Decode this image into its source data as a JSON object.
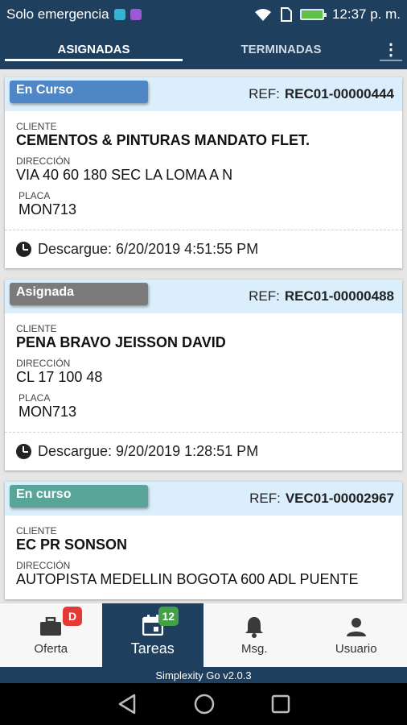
{
  "status_bar": {
    "carrier": "Solo emergencia",
    "time": "12:37 p. m."
  },
  "tabs": [
    {
      "label": "ASIGNADAS",
      "active": true
    },
    {
      "label": "TERMINADAS",
      "active": false
    }
  ],
  "overflow_icon": "⋮",
  "cards": [
    {
      "status": "En Curso",
      "status_color": "#4f86c6",
      "ref_label": "REF:",
      "ref": "REC01-00000444",
      "cliente_label": "CLIENTE",
      "cliente": "CEMENTOS & PINTURAS MANDATO FLET.",
      "direccion_label": "DIRECCIÓN",
      "direccion": "VIA 40 60 180 SEC LA LOMA A N",
      "placa_label": "PLACA",
      "placa": "MON713",
      "descargue": "Descargue: 6/20/2019 4:51:55 PM"
    },
    {
      "status": "Asignada",
      "status_color": "#7b7b7b",
      "ref_label": "REF:",
      "ref": "REC01-00000488",
      "cliente_label": "CLIENTE",
      "cliente": "PENA BRAVO JEISSON DAVID",
      "direccion_label": "DIRECCIÓN",
      "direccion": "CL 17 100 48",
      "placa_label": "PLACA",
      "placa": "MON713",
      "descargue": "Descargue: 9/20/2019 1:28:51 PM"
    },
    {
      "status": "En curso",
      "status_color": "#5aa59a",
      "ref_label": "REF:",
      "ref": "VEC01-00002967",
      "cliente_label": "CLIENTE",
      "cliente": "EC PR SONSON",
      "direccion_label": "DIRECCIÓN",
      "direccion": "AUTOPISTA MEDELLIN BOGOTA 600 ADL PUENTE"
    }
  ],
  "bottom_nav": [
    {
      "label": "Oferta",
      "icon": "briefcase-icon",
      "badge": "D",
      "badge_color": "#e53935",
      "active": false
    },
    {
      "label": "Tareas",
      "icon": "calendar-icon",
      "badge": "12",
      "badge_color": "#43a047",
      "active": true
    },
    {
      "label": "Msg.",
      "icon": "bell-icon",
      "active": false
    },
    {
      "label": "Usuario",
      "icon": "user-icon",
      "active": false
    }
  ],
  "version": "Simplexity Go v2.0.3",
  "colors": {
    "primary": "#1f3f5e",
    "card_header": "#dbeefb"
  }
}
